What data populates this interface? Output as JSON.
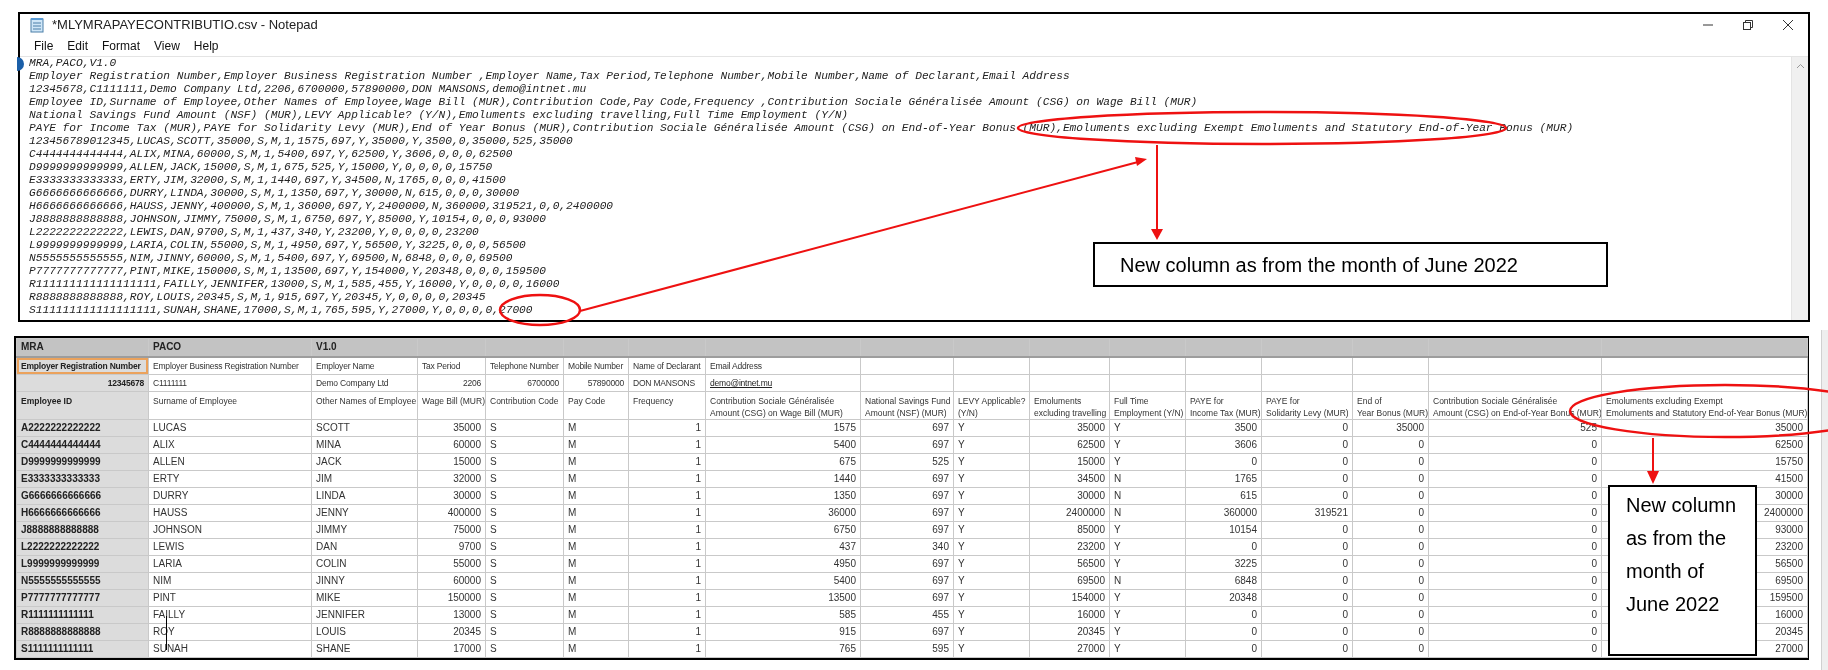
{
  "notepad": {
    "title": "*MLYMRAPAYECONTRIBUTIO.csv - Notepad",
    "menu": [
      "File",
      "Edit",
      "Format",
      "View",
      "Help"
    ],
    "lines": [
      "MRA,PACO,V1.0",
      "Employer Registration Number,Employer Business Registration Number ,Employer Name,Tax Period,Telephone Number,Mobile Number,Name of Declarant,Email Address",
      "12345678,C1111111,Demo Company Ltd,2206,6700000,57890000,DON MANSONS,demo@intnet.mu",
      "Employee ID,Surname of Employee,Other Names of Employee,Wage Bill (MUR),Contribution Code,Pay Code,Frequency ,Contribution Sociale Généralisée Amount (CSG) on Wage Bill (MUR)",
      "National Savings Fund Amount (NSF) (MUR),LEVY Applicable? (Y/N),Emoluments excluding travelling,Full Time Employment (Y/N)",
      "PAYE for Income Tax (MUR),PAYE for Solidarity Levy (MUR),End of Year Bonus (MUR),Contribution Sociale Généralisée Amount (CSG) on End-of-Year Bonus (MUR),Emoluments excluding Exempt Emoluments and Statutory End-of-Year Bonus (MUR)",
      "123456789012345,LUCAS,SCOTT,35000,S,M,1,1575,697,Y,35000,Y,3500,0,35000,525,35000",
      "C4444444444444,ALIX,MINA,60000,S,M,1,5400,697,Y,62500,Y,3606,0,0,0,62500",
      "D9999999999999,ALLEN,JACK,15000,S,M,1,675,525,Y,15000,Y,0,0,0,0,15750",
      "E3333333333333,ERTY,JIM,32000,S,M,1,1440,697,Y,34500,N,1765,0,0,0,41500",
      "G6666666666666,DURRY,LINDA,30000,S,M,1,1350,697,Y,30000,N,615,0,0,0,30000",
      "H6666666666666,HAUSS,JENNY,400000,S,M,1,36000,697,Y,2400000,N,360000,319521,0,0,2400000",
      "J8888888888888,JOHNSON,JIMMY,75000,S,M,1,6750,697,Y,85000,Y,10154,0,0,0,93000",
      "L2222222222222,LEWIS,DAN,9700,S,M,1,437,340,Y,23200,Y,0,0,0,0,23200",
      "L9999999999999,LARIA,COLIN,55000,S,M,1,4950,697,Y,56500,Y,3225,0,0,0,56500",
      "N5555555555555,NIM,JINNY,60000,S,M,1,5400,697,Y,69500,N,6848,0,0,0,69500",
      "P7777777777777,PINT,MIKE,150000,S,M,1,13500,697,Y,154000,Y,20348,0,0,0,159500",
      "R111111111111111111,FAILLY,JENNIFER,13000,S,M,1,585,455,Y,16000,Y,0,0,0,0,16000",
      "R8888888888888,ROY,LOUIS,20345,S,M,1,915,697,Y,20345,Y,0,0,0,0,20345",
      "S111111111111111111,SUNAH,SHANE,17000,S,M,1,765,595,Y,27000,Y,0,0,0,0,27000"
    ]
  },
  "spreadsheet": {
    "rows": [
      {
        "kind": "title",
        "cells": [
          "MRA",
          "PACO",
          "V1.0"
        ]
      },
      {
        "kind": "label",
        "cells": [
          {
            "text": "Employer Registration Number",
            "selected": true
          },
          {
            "text": "Employer Business Registration Number",
            "selected": false
          },
          {
            "text": "Employer Name",
            "selected": false
          },
          {
            "text": "Tax Period",
            "selected": false
          },
          {
            "text": "Telephone Number",
            "selected": false
          },
          {
            "text": "Mobile Number",
            "selected": false
          },
          {
            "text": "Name of Declarant",
            "selected": false
          },
          {
            "text": "Email Address",
            "selected": false
          }
        ]
      },
      {
        "kind": "value",
        "cells": [
          "12345678",
          "C1111111",
          "Demo Company Ltd",
          "2206",
          "6700000",
          "57890000",
          "DON MANSONS",
          "demo@intnet.mu"
        ]
      },
      {
        "kind": "header",
        "cells": [
          "Employee ID",
          "Surname of Employee",
          "Other Names of Employee",
          "Wage Bill (MUR)",
          "Contribution Code",
          "Pay Code",
          "Frequency",
          "Contribution Sociale Généralisée\nAmount (CSG) on Wage Bill (MUR)",
          "National Savings Fund\nAmount (NSF) (MUR)",
          "LEVY Applicable?\n(Y/N)",
          "Emoluments\nexcluding travelling",
          "Full Time\nEmployment (Y/N)",
          "PAYE for\nIncome Tax (MUR)",
          "PAYE for\nSolidarity Levy (MUR)",
          "End of\nYear Bonus (MUR)",
          "Contribution Sociale Généralisée\nAmount (CSG) on End-of-Year Bonus (MUR)",
          "Emoluments excluding Exempt\nEmoluments and Statutory End-of-Year Bonus (MUR)"
        ]
      },
      {
        "kind": "data",
        "cells": [
          "A2222222222222",
          "LUCAS",
          "SCOTT",
          "35000",
          "S",
          "M",
          "1",
          "1575",
          "697",
          "Y",
          "35000",
          "Y",
          "3500",
          "0",
          "35000",
          "525",
          "35000"
        ]
      },
      {
        "kind": "data",
        "cells": [
          "C4444444444444",
          "ALIX",
          "MINA",
          "60000",
          "S",
          "M",
          "1",
          "5400",
          "697",
          "Y",
          "62500",
          "Y",
          "3606",
          "0",
          "0",
          "0",
          "62500"
        ]
      },
      {
        "kind": "data",
        "cells": [
          "D9999999999999",
          "ALLEN",
          "JACK",
          "15000",
          "S",
          "M",
          "1",
          "675",
          "525",
          "Y",
          "15000",
          "Y",
          "0",
          "0",
          "0",
          "0",
          "15750"
        ]
      },
      {
        "kind": "data",
        "cells": [
          "E3333333333333",
          "ERTY",
          "JIM",
          "32000",
          "S",
          "M",
          "1",
          "1440",
          "697",
          "Y",
          "34500",
          "N",
          "1765",
          "0",
          "0",
          "0",
          "41500"
        ]
      },
      {
        "kind": "data",
        "cells": [
          "G6666666666666",
          "DURRY",
          "LINDA",
          "30000",
          "S",
          "M",
          "1",
          "1350",
          "697",
          "Y",
          "30000",
          "N",
          "615",
          "0",
          "0",
          "0",
          "30000"
        ]
      },
      {
        "kind": "data",
        "cells": [
          "H6666666666666",
          "HAUSS",
          "JENNY",
          "400000",
          "S",
          "M",
          "1",
          "36000",
          "697",
          "Y",
          "2400000",
          "N",
          "360000",
          "319521",
          "0",
          "0",
          "2400000"
        ]
      },
      {
        "kind": "data",
        "cells": [
          "J8888888888888",
          "JOHNSON",
          "JIMMY",
          "75000",
          "S",
          "M",
          "1",
          "6750",
          "697",
          "Y",
          "85000",
          "Y",
          "10154",
          "0",
          "0",
          "0",
          "93000"
        ]
      },
      {
        "kind": "data",
        "cells": [
          "L2222222222222",
          "LEWIS",
          "DAN",
          "9700",
          "S",
          "M",
          "1",
          "437",
          "340",
          "Y",
          "23200",
          "Y",
          "0",
          "0",
          "0",
          "0",
          "23200"
        ]
      },
      {
        "kind": "data",
        "cells": [
          "L9999999999999",
          "LARIA",
          "COLIN",
          "55000",
          "S",
          "M",
          "1",
          "4950",
          "697",
          "Y",
          "56500",
          "Y",
          "3225",
          "0",
          "0",
          "0",
          "56500"
        ]
      },
      {
        "kind": "data",
        "cells": [
          "N5555555555555",
          "NIM",
          "JINNY",
          "60000",
          "S",
          "M",
          "1",
          "5400",
          "697",
          "Y",
          "69500",
          "N",
          "6848",
          "0",
          "0",
          "0",
          "69500"
        ]
      },
      {
        "kind": "data",
        "cells": [
          "P7777777777777",
          "PINT",
          "MIKE",
          "150000",
          "S",
          "M",
          "1",
          "13500",
          "697",
          "Y",
          "154000",
          "Y",
          "20348",
          "0",
          "0",
          "0",
          "159500"
        ]
      },
      {
        "kind": "data",
        "cells": [
          "R1111111111111",
          "FAILLY",
          "JENNIFER",
          "13000",
          "S",
          "M",
          "1",
          "585",
          "455",
          "Y",
          "16000",
          "Y",
          "0",
          "0",
          "0",
          "0",
          "16000"
        ]
      },
      {
        "kind": "data",
        "cells": [
          "R8888888888888",
          "ROY",
          "LOUIS",
          "20345",
          "S",
          "M",
          "1",
          "915",
          "697",
          "Y",
          "20345",
          "Y",
          "0",
          "0",
          "0",
          "0",
          "20345"
        ]
      },
      {
        "kind": "data",
        "cells": [
          "S1111111111111",
          "SUNAH",
          "SHANE",
          "17000",
          "S",
          "M",
          "1",
          "765",
          "595",
          "Y",
          "27000",
          "Y",
          "0",
          "0",
          "0",
          "0",
          "27000"
        ]
      }
    ]
  },
  "annotations": [
    "New column as from the month of June 2022",
    "New column as from the month of June 2022"
  ]
}
